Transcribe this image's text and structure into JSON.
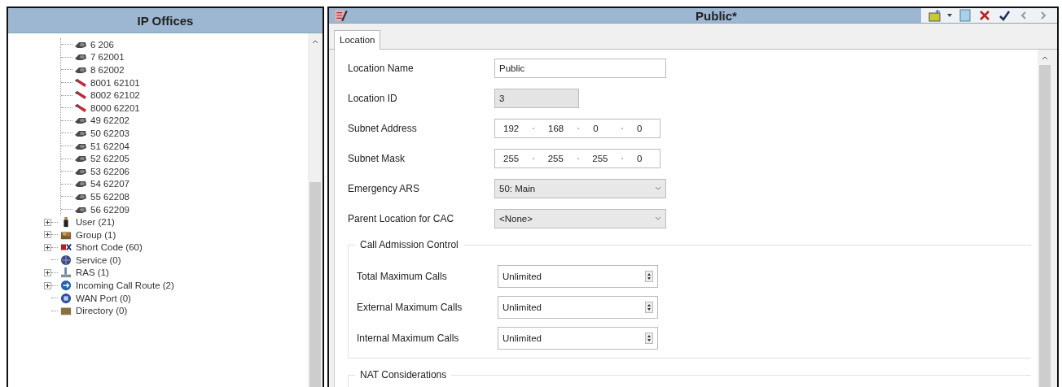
{
  "left_panel": {
    "title": "IP Offices",
    "extensions": [
      {
        "label": "6 206",
        "kind": "phone"
      },
      {
        "label": "7 62001",
        "kind": "phone"
      },
      {
        "label": "8 62002",
        "kind": "phone"
      },
      {
        "label": "8001 62101",
        "kind": "sip"
      },
      {
        "label": "8002 62102",
        "kind": "sip"
      },
      {
        "label": "8000 62201",
        "kind": "sip"
      },
      {
        "label": "49 62202",
        "kind": "phone"
      },
      {
        "label": "50 62203",
        "kind": "phone"
      },
      {
        "label": "51 62204",
        "kind": "phone"
      },
      {
        "label": "52 62205",
        "kind": "phone"
      },
      {
        "label": "53 62206",
        "kind": "phone"
      },
      {
        "label": "54 62207",
        "kind": "phone"
      },
      {
        "label": "55 62208",
        "kind": "phone"
      },
      {
        "label": "56 62209",
        "kind": "phone"
      }
    ],
    "nodes": [
      {
        "label": "User (21)",
        "kind": "user",
        "expander": true
      },
      {
        "label": "Group (1)",
        "kind": "group",
        "expander": true
      },
      {
        "label": "Short Code (60)",
        "kind": "shortcode",
        "expander": true
      },
      {
        "label": "Service (0)",
        "kind": "service",
        "expander": false
      },
      {
        "label": "RAS (1)",
        "kind": "ras",
        "expander": true
      },
      {
        "label": "Incoming Call Route (2)",
        "kind": "route",
        "expander": true
      },
      {
        "label": "WAN Port (0)",
        "kind": "wan",
        "expander": false
      },
      {
        "label": "Directory (0)",
        "kind": "directory",
        "expander": false
      }
    ]
  },
  "right_panel": {
    "title": "Public*",
    "tabs": [
      {
        "label": "Location",
        "selected": true
      }
    ],
    "fields": [
      {
        "label": "Location Name",
        "kind": "text",
        "value": "Public",
        "disabled": false
      },
      {
        "label": "Location ID",
        "kind": "text",
        "value": "3",
        "disabled": true
      },
      {
        "label": "Subnet Address",
        "kind": "ip",
        "octets": [
          "192",
          "168",
          "0",
          "0"
        ]
      },
      {
        "label": "Subnet Mask",
        "kind": "ip",
        "octets": [
          "255",
          "255",
          "255",
          "0"
        ]
      },
      {
        "label": "Emergency ARS",
        "kind": "select",
        "value": "50: Main"
      },
      {
        "label": "Parent Location for CAC",
        "kind": "select",
        "value": "<None>"
      }
    ],
    "groups": [
      {
        "title": "Call Admission Control",
        "fields": [
          {
            "label": "Total Maximum Calls",
            "value": "Unlimited"
          },
          {
            "label": "External Maximum Calls",
            "value": "Unlimited"
          },
          {
            "label": "Internal Maximum Calls",
            "value": "Unlimited"
          }
        ]
      },
      {
        "title": "NAT Considerations"
      }
    ]
  }
}
